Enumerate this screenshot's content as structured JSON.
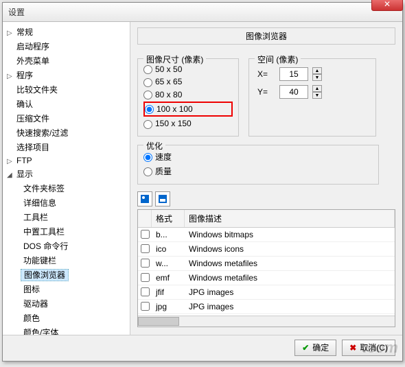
{
  "window": {
    "title": "设置"
  },
  "sidebar": {
    "items": [
      {
        "label": "常规",
        "exp": "▷"
      },
      {
        "label": "启动程序"
      },
      {
        "label": "外壳菜单"
      },
      {
        "label": "程序",
        "exp": "▷"
      },
      {
        "label": "比较文件夹"
      },
      {
        "label": "确认"
      },
      {
        "label": "压缩文件"
      },
      {
        "label": "快速搜索/过滤"
      },
      {
        "label": "选择项目"
      },
      {
        "label": "FTP",
        "exp": "▷"
      },
      {
        "label": "显示",
        "exp": "◢",
        "children": [
          {
            "label": "文件夹标签"
          },
          {
            "label": "详细信息"
          },
          {
            "label": "工具栏"
          },
          {
            "label": "中置工具栏"
          },
          {
            "label": "DOS 命令行"
          },
          {
            "label": "功能键栏"
          },
          {
            "label": "图像浏览器",
            "selected": true
          },
          {
            "label": "图标"
          },
          {
            "label": "驱动器"
          },
          {
            "label": "颜色"
          },
          {
            "label": "颜色/字体"
          }
        ]
      }
    ]
  },
  "content": {
    "section_title": "图像浏览器",
    "size_group": {
      "title": "图像尺寸 (像素)",
      "options": [
        "50 x 50",
        "65 x 65",
        "80 x 80",
        "100 x 100",
        "150 x 150"
      ],
      "selected": "100 x 100"
    },
    "space_group": {
      "title": "空间 (像素)",
      "x_label": "X=",
      "x_value": "15",
      "y_label": "Y=",
      "y_value": "40"
    },
    "opt_group": {
      "title": "优化",
      "options": [
        "速度",
        "质量"
      ],
      "selected": "速度"
    },
    "table": {
      "col_format": "格式",
      "col_desc": "图像描述",
      "rows": [
        {
          "fmt": "b...",
          "desc": "Windows bitmaps"
        },
        {
          "fmt": "ico",
          "desc": "Windows icons"
        },
        {
          "fmt": "w...",
          "desc": "Windows metafiles"
        },
        {
          "fmt": "emf",
          "desc": "Windows metafiles"
        },
        {
          "fmt": "jfif",
          "desc": "JPG images"
        },
        {
          "fmt": "jpg",
          "desc": "JPG images"
        }
      ]
    }
  },
  "footer": {
    "ok": "确定",
    "cancel": "取消(C)"
  }
}
